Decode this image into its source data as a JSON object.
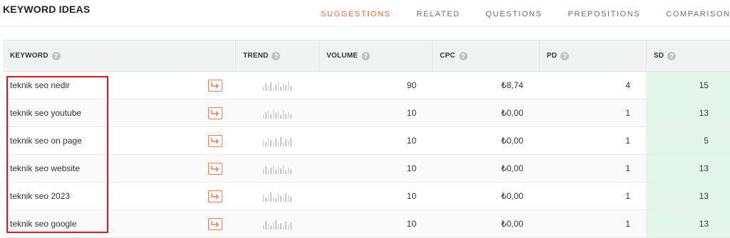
{
  "header": {
    "title": "KEYWORD IDEAS",
    "tabs": [
      {
        "label": "SUGGESTIONS",
        "active": true
      },
      {
        "label": "RELATED",
        "active": false
      },
      {
        "label": "QUESTIONS",
        "active": false
      },
      {
        "label": "PREPOSITIONS",
        "active": false
      },
      {
        "label": "COMPARISONS",
        "active": false
      }
    ]
  },
  "table": {
    "columns": {
      "keyword": "KEYWORD",
      "trend": "TREND",
      "volume": "VOLUME",
      "cpc": "CPC",
      "pd": "PD",
      "sd": "SD"
    },
    "help_glyph": "?",
    "rows": [
      {
        "keyword": "teknik seo nedir",
        "volume": "90",
        "cpc": "₺8,74",
        "pd": "4",
        "sd": "15"
      },
      {
        "keyword": "teknik seo youtube",
        "volume": "10",
        "cpc": "₺0,00",
        "pd": "1",
        "sd": "13"
      },
      {
        "keyword": "teknik seo on page",
        "volume": "10",
        "cpc": "₺0,00",
        "pd": "1",
        "sd": "5"
      },
      {
        "keyword": "teknik seo website",
        "volume": "10",
        "cpc": "₺0,00",
        "pd": "1",
        "sd": "13"
      },
      {
        "keyword": "teknik seo 2023",
        "volume": "10",
        "cpc": "₺0,00",
        "pd": "1",
        "sd": "13"
      },
      {
        "keyword": "teknik seo google",
        "volume": "10",
        "cpc": "₺0,00",
        "pd": "1",
        "sd": "13"
      }
    ]
  },
  "colors": {
    "accent": "#e8693e",
    "sd_highlight": "#e3f6ec",
    "annotation_box": "#e0151c"
  },
  "icons": {
    "help": "question-circle-icon",
    "row_action": "arrow-redirect-icon",
    "trend": "trend-sparkline-icon"
  }
}
